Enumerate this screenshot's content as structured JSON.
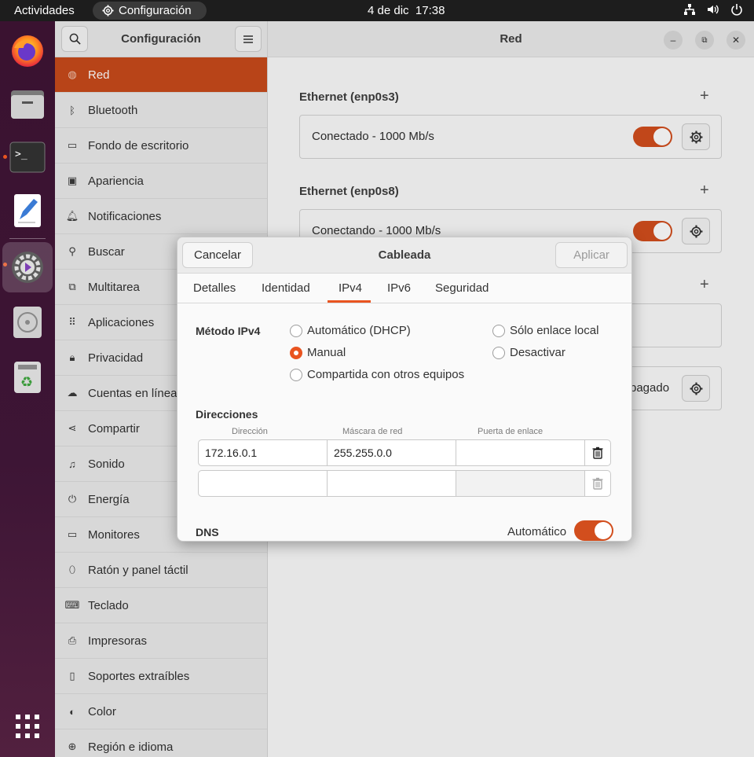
{
  "topbar": {
    "activities": "Actividades",
    "app_menu": "Configuración",
    "date": "4 de dic",
    "time": "17:38"
  },
  "dock": {
    "items": [
      "firefox-icon",
      "files-icon",
      "terminal-icon",
      "text-editor-icon",
      "settings-icon",
      "disc-icon",
      "trash-icon",
      "app-grid-icon"
    ]
  },
  "sidebar": {
    "title": "Configuración",
    "items": [
      {
        "label": "Red",
        "icon": "network-icon"
      },
      {
        "label": "Bluetooth",
        "icon": "bluetooth-icon"
      },
      {
        "label": "Fondo de escritorio",
        "icon": "wallpaper-icon"
      },
      {
        "label": "Apariencia",
        "icon": "appearance-icon"
      },
      {
        "label": "Notificaciones",
        "icon": "bell-icon"
      },
      {
        "label": "Buscar",
        "icon": "search-icon"
      },
      {
        "label": "Multitarea",
        "icon": "multitask-icon"
      },
      {
        "label": "Aplicaciones",
        "icon": "apps-icon"
      },
      {
        "label": "Privacidad",
        "icon": "lock-icon"
      },
      {
        "label": "Cuentas en línea",
        "icon": "cloud-icon"
      },
      {
        "label": "Compartir",
        "icon": "share-icon"
      },
      {
        "label": "Sonido",
        "icon": "music-icon"
      },
      {
        "label": "Energía",
        "icon": "power-icon"
      },
      {
        "label": "Monitores",
        "icon": "monitor-icon"
      },
      {
        "label": "Ratón y panel táctil",
        "icon": "mouse-icon"
      },
      {
        "label": "Teclado",
        "icon": "keyboard-icon"
      },
      {
        "label": "Impresoras",
        "icon": "printer-icon"
      },
      {
        "label": "Soportes extraíbles",
        "icon": "usb-icon"
      },
      {
        "label": "Color",
        "icon": "color-icon"
      },
      {
        "label": "Región e idioma",
        "icon": "globe-icon"
      }
    ]
  },
  "main": {
    "title": "Red",
    "eth1_title": "Ethernet (enp0s3)",
    "eth1_status": "Conectado - 1000 Mb/s",
    "eth2_title": "Ethernet (enp0s8)",
    "eth2_status": "Conectando - 1000 Mb/s",
    "vpn_status_partial": "pagado"
  },
  "dialog": {
    "title": "Cableada",
    "cancel": "Cancelar",
    "apply": "Aplicar",
    "tabs": [
      "Detalles",
      "Identidad",
      "IPv4",
      "IPv6",
      "Seguridad"
    ],
    "active_tab": "IPv4",
    "method_label": "Método IPv4",
    "methods": {
      "auto": "Automático (DHCP)",
      "link_local": "Sólo enlace local",
      "manual": "Manual",
      "disable": "Desactivar",
      "shared": "Compartida con otros equipos"
    },
    "selected_method": "Manual",
    "addresses_label": "Direcciones",
    "columns": [
      "Dirección",
      "Máscara de red",
      "Puerta de enlace"
    ],
    "rows": [
      {
        "address": "172.16.0.1",
        "netmask": "255.255.0.0",
        "gateway": ""
      },
      {
        "address": "",
        "netmask": "",
        "gateway": ""
      }
    ],
    "dns_label": "DNS",
    "dns_auto": "Automático"
  },
  "colors": {
    "accent": "#e95420",
    "sidebar_selected": "#c84a1b"
  }
}
